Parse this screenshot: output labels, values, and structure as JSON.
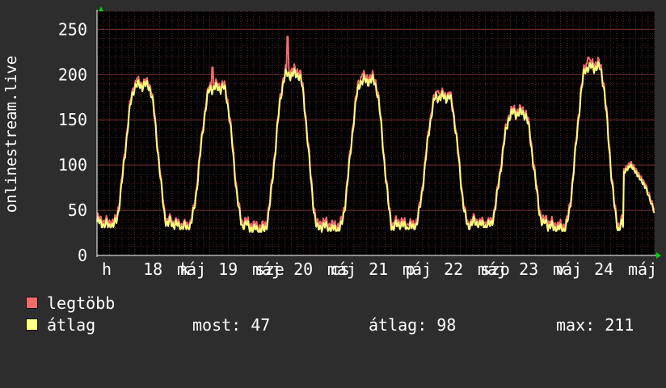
{
  "chart_data": {
    "type": "line",
    "ylabel": "onlinestream.live",
    "ylim": [
      0,
      270
    ],
    "yticks": [
      0,
      50,
      100,
      150,
      200,
      250
    ],
    "xlim": [
      0,
      7.42
    ],
    "x_tick_labels": [
      {
        "x": 0.0,
        "label": "h"
      },
      {
        "x": 0.55,
        "label": "18"
      },
      {
        "x": 1.0,
        "label": "máj"
      },
      {
        "x": 1.04,
        "label": "k"
      },
      {
        "x": 1.55,
        "label": "19"
      },
      {
        "x": 2.0,
        "label": "máj"
      },
      {
        "x": 2.04,
        "label": "sze"
      },
      {
        "x": 2.55,
        "label": "20"
      },
      {
        "x": 3.0,
        "label": "máj"
      },
      {
        "x": 3.04,
        "label": "cs"
      },
      {
        "x": 3.55,
        "label": "21"
      },
      {
        "x": 4.0,
        "label": "máj"
      },
      {
        "x": 4.04,
        "label": "p"
      },
      {
        "x": 4.55,
        "label": "22"
      },
      {
        "x": 5.0,
        "label": "máj"
      },
      {
        "x": 5.04,
        "label": "szo"
      },
      {
        "x": 5.55,
        "label": "23"
      },
      {
        "x": 6.0,
        "label": "máj"
      },
      {
        "x": 6.04,
        "label": "v"
      },
      {
        "x": 6.55,
        "label": "24"
      },
      {
        "x": 7.0,
        "label": "máj"
      }
    ],
    "grid": true,
    "days": [
      {
        "min": 33,
        "peak": 188,
        "spike": 196
      },
      {
        "min": 31,
        "peak": 185,
        "spike": 208
      },
      {
        "min": 28,
        "peak": 200,
        "spike": 242
      },
      {
        "min": 29,
        "peak": 193,
        "spike": 201
      },
      {
        "min": 31,
        "peak": 175,
        "spike": 182
      },
      {
        "min": 33,
        "peak": 157,
        "spike": 161
      },
      {
        "min": 29,
        "peak": 208,
        "spike": 219
      }
    ],
    "tail": {
      "x": [
        7.0,
        7.1,
        7.2,
        7.3,
        7.42
      ],
      "values": [
        90,
        100,
        88,
        75,
        47
      ]
    },
    "series": [
      {
        "name": "legtöbb",
        "color": "#f26b6b"
      },
      {
        "name": "átlag",
        "color": "#ffff80"
      }
    ]
  },
  "legend": {
    "max_label": "legtöbb",
    "avg_label": "átlag",
    "max_color": "#f26b6b",
    "avg_color": "#ffff80"
  },
  "stats": {
    "now": "most: 47",
    "average": "átlag: 98",
    "maximum": "max: 211"
  }
}
